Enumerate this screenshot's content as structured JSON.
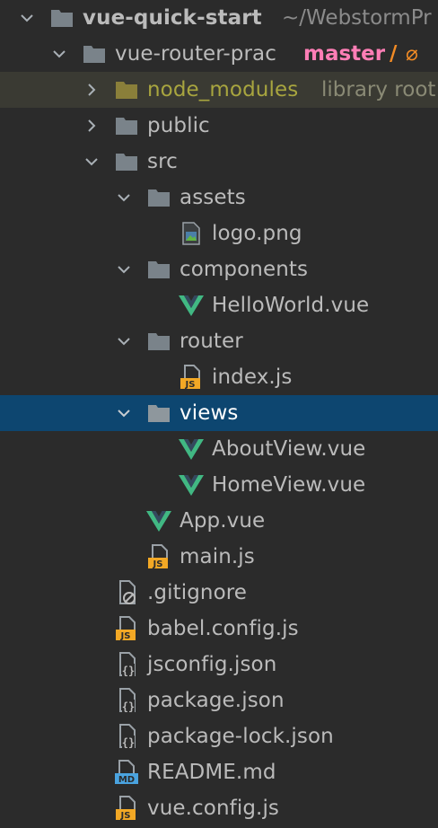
{
  "colors": {
    "background": "#2b2b2b",
    "selected_row": "#0d4670",
    "excluded_row": "#3a3a33",
    "text": "#bbbbbb",
    "folder": "#7a838a",
    "vue_green": "#41b883",
    "vue_dark": "#34495e",
    "js_orange": "#f2a825",
    "md_blue": "#4aa3df",
    "branch_pink": "#ff7eb6"
  },
  "tree": {
    "root": {
      "label": "vue-quick-start",
      "path": "~/WebstormPr",
      "icon": "folder-icon"
    },
    "project": {
      "label": "vue-router-prac",
      "branch": "master",
      "branch_separator": "/",
      "branch_extra": "⌀",
      "icon": "folder-icon"
    },
    "items": [
      {
        "label": "node_modules",
        "suffix": "library root",
        "icon": "folder-icon",
        "expanded": false
      },
      {
        "label": "public",
        "icon": "folder-icon",
        "expanded": false
      },
      {
        "label": "src",
        "icon": "folder-icon",
        "expanded": true
      },
      {
        "label": "assets",
        "icon": "folder-icon",
        "expanded": true
      },
      {
        "label": "logo.png",
        "icon": "image-file-icon"
      },
      {
        "label": "components",
        "icon": "folder-icon",
        "expanded": true
      },
      {
        "label": "HelloWorld.vue",
        "icon": "vue-file-icon"
      },
      {
        "label": "router",
        "icon": "folder-icon",
        "expanded": true
      },
      {
        "label": "index.js",
        "icon": "js-file-icon",
        "badge": "JS"
      },
      {
        "label": "views",
        "icon": "folder-icon",
        "expanded": true,
        "selected": true
      },
      {
        "label": "AboutView.vue",
        "icon": "vue-file-icon"
      },
      {
        "label": "HomeView.vue",
        "icon": "vue-file-icon"
      },
      {
        "label": "App.vue",
        "icon": "vue-file-icon"
      },
      {
        "label": "main.js",
        "icon": "js-file-icon",
        "badge": "JS"
      },
      {
        "label": ".gitignore",
        "icon": "ignore-file-icon"
      },
      {
        "label": "babel.config.js",
        "icon": "js-file-icon",
        "badge": "JS"
      },
      {
        "label": "jsconfig.json",
        "icon": "json-file-icon",
        "badge": "{}"
      },
      {
        "label": "package.json",
        "icon": "json-file-icon",
        "badge": "{}"
      },
      {
        "label": "package-lock.json",
        "icon": "json-file-icon",
        "badge": "{}"
      },
      {
        "label": "README.md",
        "icon": "markdown-file-icon",
        "badge": "MD"
      },
      {
        "label": "vue.config.js",
        "icon": "js-file-icon",
        "badge": "JS"
      }
    ]
  }
}
